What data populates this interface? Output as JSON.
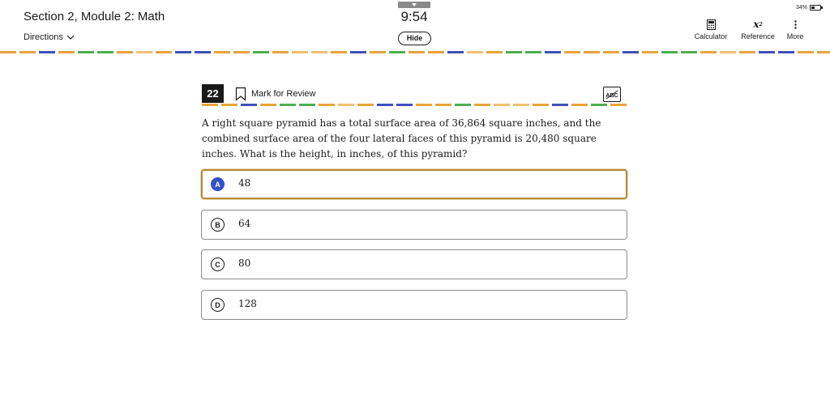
{
  "header": {
    "section_title": "Section 2, Module 2: Math",
    "directions_label": "Directions",
    "timer": "9:54",
    "hide_label": "Hide",
    "battery_text": "34%",
    "battery_level": 0.34,
    "tools": [
      {
        "label": "Calculator",
        "icon": "calculator-icon"
      },
      {
        "label": "Reference",
        "icon": "reference-icon",
        "glyph": "x²"
      },
      {
        "label": "More",
        "icon": "more-vertical-icon"
      }
    ]
  },
  "question": {
    "number": "22",
    "mark_for_review_label": "Mark for Review",
    "abc_icon": "answer-eliminator-icon",
    "text": "A right square pyramid has a total surface area of 36,864 square inches, and the combined surface area of the four lateral faces of this pyramid is 20,480 square inches. What is the height, in inches, of this pyramid?",
    "choices": [
      {
        "letter": "A",
        "text": "48",
        "selected": true
      },
      {
        "letter": "B",
        "text": "64",
        "selected": false
      },
      {
        "letter": "C",
        "text": "80",
        "selected": false
      },
      {
        "letter": "D",
        "text": "128",
        "selected": false
      }
    ]
  },
  "colors": {
    "selected_border": "#b5893a",
    "selected_letter_bg": "#3350c8",
    "dash_colors": [
      "#e8a33a",
      "#3f4fbd",
      "#4caf50",
      "#f0c070"
    ]
  }
}
